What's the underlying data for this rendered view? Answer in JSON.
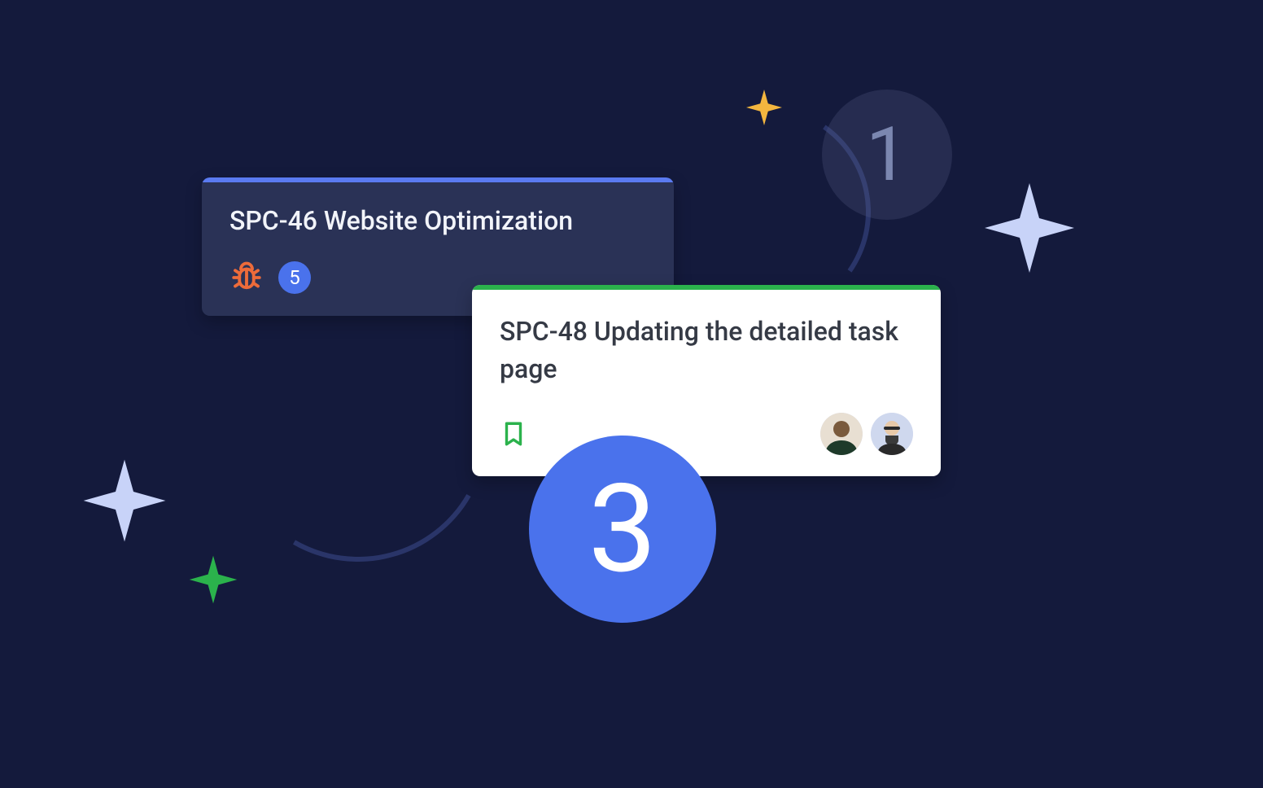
{
  "badges": {
    "one": "1",
    "three": "3"
  },
  "card_a": {
    "title": "SPC-46 Website Optimization",
    "count": "5",
    "stripe_color": "#5a7af0",
    "icon": "bug-icon"
  },
  "card_b": {
    "title": "SPC-48 Updating the detailed task page",
    "stripe_color": "#2bb24c",
    "icon": "bookmark-icon",
    "assignees": [
      "avatar-1",
      "avatar-2"
    ]
  },
  "sparks": {
    "yellow": "#f3b63f",
    "green": "#2bb24c",
    "lilac_small": "#c8d3f8",
    "lilac_large": "#c8d3f8"
  }
}
